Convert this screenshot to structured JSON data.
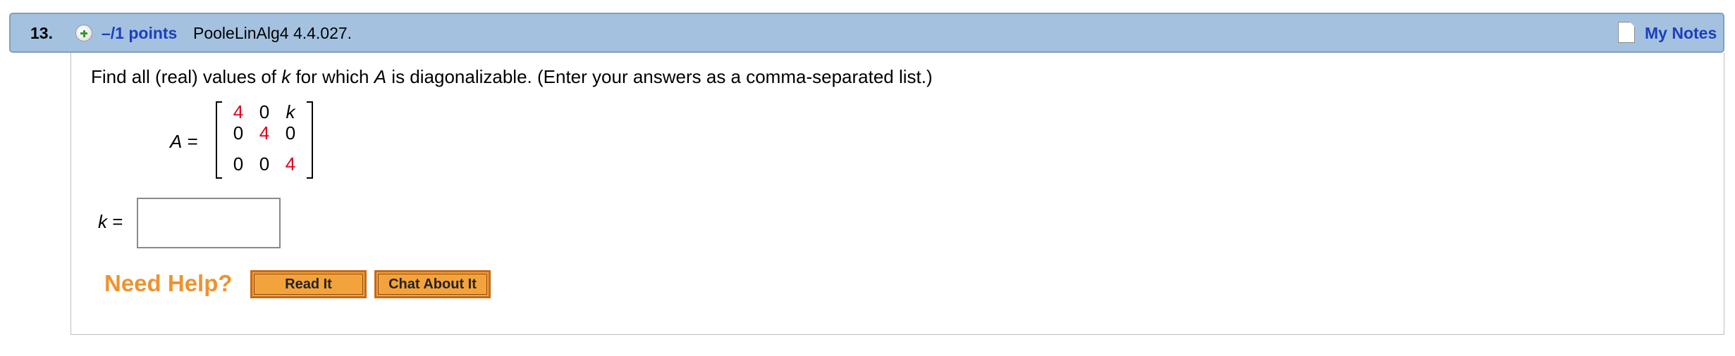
{
  "question": {
    "number": "13.",
    "points": "–/1 points",
    "code": "PooleLinAlg4 4.4.027.",
    "my_notes": "My Notes"
  },
  "prompt": {
    "part1": "Find all (real) values of ",
    "var_k": "k",
    "part2": " for which ",
    "var_A": "A",
    "part3": " is diagonalizable. (Enter your answers as a comma-separated list.)"
  },
  "matrix": {
    "label_var": "A",
    "label_eq": " =",
    "rows": [
      [
        "4",
        "0",
        "k"
      ],
      [
        "0",
        "4",
        "0"
      ],
      [
        "0",
        "0",
        "4"
      ]
    ],
    "highlight_color": "#e0001b"
  },
  "answer": {
    "label_var": "k",
    "label_eq": " =",
    "value": "",
    "placeholder": ""
  },
  "help": {
    "label": "Need Help?",
    "read_it": "Read It",
    "chat_about_it": "Chat About It"
  },
  "colors": {
    "header_bg": "#a4c2e0",
    "link": "#1c3fbd",
    "help_orange": "#f0922f"
  }
}
